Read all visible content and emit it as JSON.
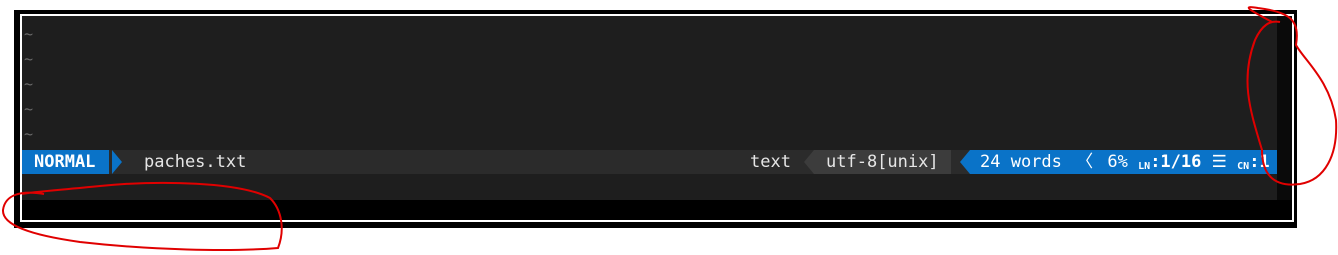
{
  "editor": {
    "empty_line_marker": "~",
    "empty_lines": [
      "~",
      "~",
      "~",
      "~",
      "~"
    ]
  },
  "statusline": {
    "mode": "NORMAL",
    "filename": "paches.txt",
    "filetype": "text",
    "encoding": "utf-8[unix]",
    "word_count": "24 words",
    "separator": "〈",
    "percent": "6%",
    "line_icon_top": "L",
    "line_icon_sub": "N",
    "line_position": ":1/16",
    "menu_icon": "☰",
    "col_icon_top": "C",
    "col_icon_sub": "N",
    "column": ":1"
  },
  "colors": {
    "mode_bg": "#0a73c8",
    "statusline_bg": "#2b2b2b",
    "editor_bg": "#1e1e1e",
    "annotation": "#e00000"
  }
}
